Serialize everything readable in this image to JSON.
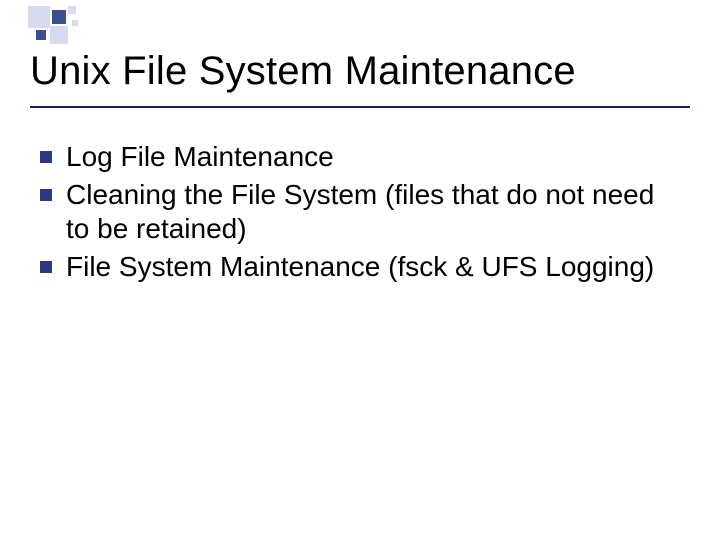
{
  "title": "Unix File System Maintenance",
  "bullets": [
    "Log File Maintenance",
    "Cleaning the File System (files that do not need to be retained)",
    "File System Maintenance (fsck & UFS Logging)"
  ]
}
